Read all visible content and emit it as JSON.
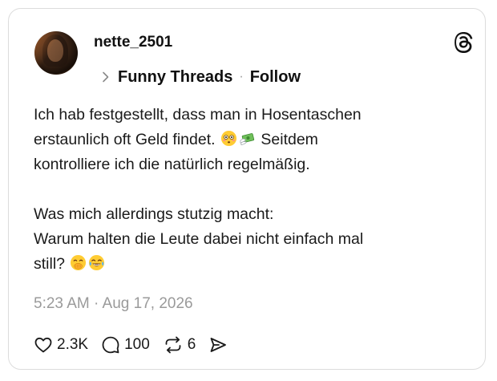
{
  "post": {
    "username": "nette_2501",
    "community": "Funny Threads",
    "separator": "·",
    "follow_label": "Follow",
    "body": {
      "line1": "Ich hab festgestellt, dass man in Hosentaschen",
      "line2_a": "erstaunlich oft Geld findet.",
      "line2_b": "Seitdem",
      "line3": "kontrolliere ich die natürlich regelmäßig.",
      "line4": "Was mich allerdings stutzig macht:",
      "line5": "Warum halten die Leute dabei nicht einfach mal",
      "line6": "still?"
    },
    "emojis": [
      "flushed-face",
      "money-with-wings",
      "hand-over-mouth",
      "tears-of-joy"
    ],
    "timestamp": "5:23 AM · Aug 17, 2026",
    "stats": {
      "likes": "2.3K",
      "replies": "100",
      "reposts": "6"
    }
  },
  "icons": {
    "brand": "threads-logo-icon",
    "like": "heart-icon",
    "reply": "comment-bubble-icon",
    "repost": "repost-icon",
    "share": "send-icon",
    "chevron": "chevron-right-icon"
  },
  "colors": {
    "text": "#1a1a1a",
    "muted": "#9a9a9a",
    "border": "#dcdcdc",
    "background": "#ffffff"
  }
}
